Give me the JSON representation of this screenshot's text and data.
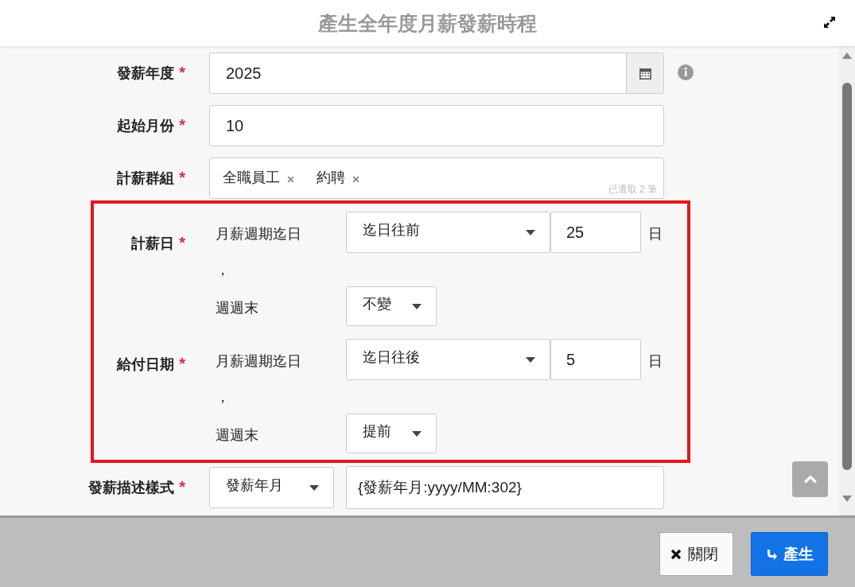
{
  "dialog": {
    "title": "產生全年度月薪發薪時程"
  },
  "fields": [
    {
      "kind": "date",
      "label": "發薪年度",
      "mark": "*",
      "value": "2025"
    },
    {
      "kind": "text",
      "label": "起始月份",
      "mark": "*",
      "value": "10"
    },
    {
      "kind": "tags",
      "label": "計薪群組",
      "mark": "*",
      "tags": [
        "全職員工",
        "約聘"
      ],
      "count": "已選取 2 筆"
    }
  ],
  "rules": [
    {
      "label": "計薪日",
      "mark": "*",
      "base": "月薪週期迄日",
      "direction": "迄日往前",
      "days": "25",
      "unit": "日",
      "comma": "，",
      "weekend_label": "週週末",
      "weekend": "不變"
    },
    {
      "label": "給付日期",
      "mark": "*",
      "base": "月薪週期迄日",
      "direction": "迄日往後",
      "days": "5",
      "unit": "日",
      "comma": "，",
      "weekend_label": "週週末",
      "weekend": "提前"
    }
  ],
  "format": {
    "label": "發薪描述樣式",
    "mark": "*",
    "select": "發薪年月",
    "value": "{發薪年月:yyyy/MM:302}"
  },
  "buttons": [
    {
      "kind": "close",
      "label": "關閉"
    },
    {
      "kind": "primary",
      "label": "產生"
    }
  ]
}
